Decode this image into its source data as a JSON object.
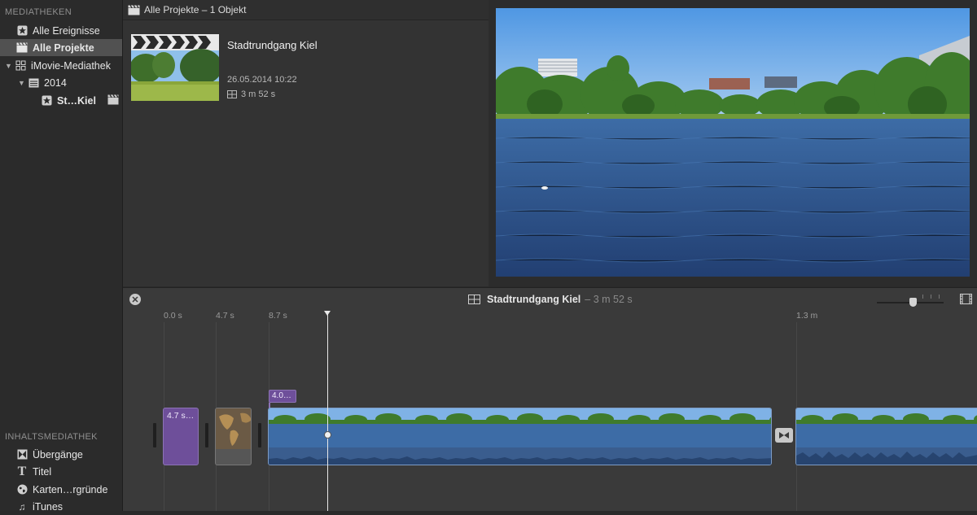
{
  "sidebar": {
    "libraries_heading": "MEDIATHEKEN",
    "items": [
      {
        "label": "Alle Ereignisse",
        "icon": "star-icon"
      },
      {
        "label": "Alle Projekte",
        "icon": "clapperboard-icon",
        "selected": true
      },
      {
        "label": "iMovie-Mediathek",
        "icon": "grid-icon"
      },
      {
        "label": "2014",
        "icon": "calendar-icon"
      },
      {
        "label": "St…Kiel",
        "icon": "star-icon"
      }
    ],
    "content_heading": "INHALTSMEDIATHEK",
    "content_items": [
      {
        "label": "Übergänge",
        "icon": "transition-icon"
      },
      {
        "label": "Titel",
        "icon": "title-t-icon"
      },
      {
        "label": "Karten…rgründe",
        "icon": "globe-icon"
      },
      {
        "label": "iTunes",
        "icon": "music-note-icon"
      }
    ]
  },
  "browser": {
    "header": "Alle Projekte – 1 Objekt",
    "project": {
      "title": "Stadtrundgang Kiel",
      "date": "26.05.2014 10:22",
      "duration": "3 m 52 s"
    }
  },
  "timeline": {
    "project_name": "Stadtrundgang Kiel",
    "project_duration": "– 3 m 52 s",
    "ticks": [
      "0.0 s",
      "4.7 s",
      "8.7 s",
      "1.3 m"
    ],
    "title_clip_label": "4.7 s…",
    "overlay_label": "4.0…",
    "zoom_level": 0.55
  },
  "colors": {
    "accent_purple": "#6e4f9a",
    "selection": "#515151",
    "sky": "#5c9fe0",
    "water": "#2f5590"
  }
}
